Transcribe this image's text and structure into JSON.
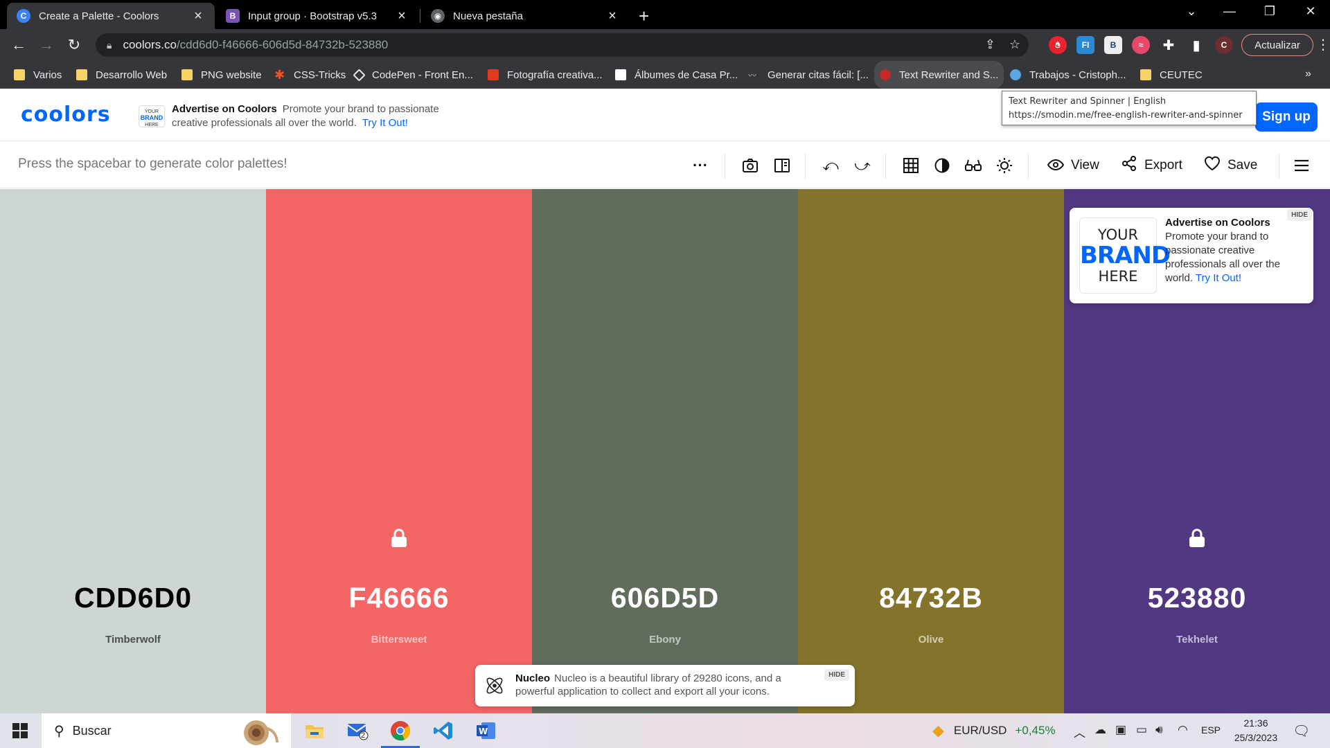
{
  "browser": {
    "tabs": [
      {
        "title": "Create a Palette - Coolors",
        "icon": "coolors-favicon",
        "active": true
      },
      {
        "title": "Input group · Bootstrap v5.3",
        "icon": "bootstrap-favicon",
        "active": false
      },
      {
        "title": "Nueva pestaña",
        "icon": "chrome-favicon",
        "active": false
      }
    ],
    "url_host": "coolors.co",
    "url_path": "/cdd6d0-f46666-606d5d-84732b-523880",
    "update_label": "Actualizar",
    "profile_initial": "C",
    "bookmarks": [
      {
        "label": "Varios",
        "icon": "folder"
      },
      {
        "label": "Desarrollo Web",
        "icon": "folder"
      },
      {
        "label": "PNG website",
        "icon": "folder"
      },
      {
        "label": "CSS-Tricks",
        "icon": "css-tricks"
      },
      {
        "label": "CodePen - Front En...",
        "icon": "codepen"
      },
      {
        "label": "Fotografía creativa...",
        "icon": "red-app"
      },
      {
        "label": "Álbumes de Casa Pr...",
        "icon": "flickr"
      },
      {
        "label": "Generar citas fácil: [...",
        "icon": "mustache"
      },
      {
        "label": "Text Rewriter and S...",
        "icon": "smodin"
      },
      {
        "label": "Trabajos - Cristoph...",
        "icon": "blue-app"
      },
      {
        "label": "CEUTEC",
        "icon": "folder"
      }
    ],
    "bookmarks_more": "»"
  },
  "tooltip": {
    "line1": "Text Rewriter and Spinner | English",
    "line2": "https://smodin.me/free-english-rewriter-and-spinner"
  },
  "header": {
    "logo": "coolors",
    "ad_logo_small": {
      "your": "YOUR",
      "brand": "BRAND",
      "here": "HERE"
    },
    "ad_heading": "Advertise on Coolors",
    "ad_body": "Promote your brand to passionate creative professionals all over the world.",
    "ad_link": "Try It Out!",
    "signup_label": "Sign up"
  },
  "toolbar": {
    "hint": "Press the spacebar to generate color palettes!",
    "more_label": "···",
    "view_label": "View",
    "export_label": "Export",
    "save_label": "Save"
  },
  "palette": [
    {
      "hex": "CDD6D0",
      "name": "Timberwolf",
      "color": "#CDD6D0",
      "text_color": "#000000",
      "name_color": "#4a4f4c",
      "locked": false
    },
    {
      "hex": "F46666",
      "name": "Bittersweet",
      "color": "#F46666",
      "text_color": "#ffffff",
      "name_color": "#f8c3c3",
      "locked": true
    },
    {
      "hex": "606D5D",
      "name": "Ebony",
      "color": "#606D5D",
      "text_color": "#ffffff",
      "name_color": "#c2c8c1",
      "locked": false
    },
    {
      "hex": "84732B",
      "name": "Olive",
      "color": "#84732B",
      "text_color": "#ffffff",
      "name_color": "#d6cfb2",
      "locked": false
    },
    {
      "hex": "523880",
      "name": "Tekhelet",
      "color": "#523880",
      "text_color": "#ffffff",
      "name_color": "#c7bcdc",
      "locked": true
    }
  ],
  "ad_card": {
    "brand": {
      "your": "YOUR",
      "brand": "BRAND",
      "here": "HERE"
    },
    "heading": "Advertise on Coolors",
    "body": "Promote your brand to passionate creative professionals all over the world.",
    "link": "Try It Out!",
    "hide": "HIDE"
  },
  "nucleo": {
    "heading": "Nucleo",
    "body": "Nucleo is a beautiful library of 29280 icons, and a powerful application to collect and export all your icons.",
    "hide": "HIDE"
  },
  "taskbar": {
    "search_placeholder": "Buscar",
    "mail_badge": "2",
    "ticker_label": "EUR/USD",
    "ticker_change": "+0,45%",
    "language": "ESP",
    "time": "21:36",
    "date": "25/3/2023"
  },
  "colors": {
    "accent": "#0066ff"
  }
}
